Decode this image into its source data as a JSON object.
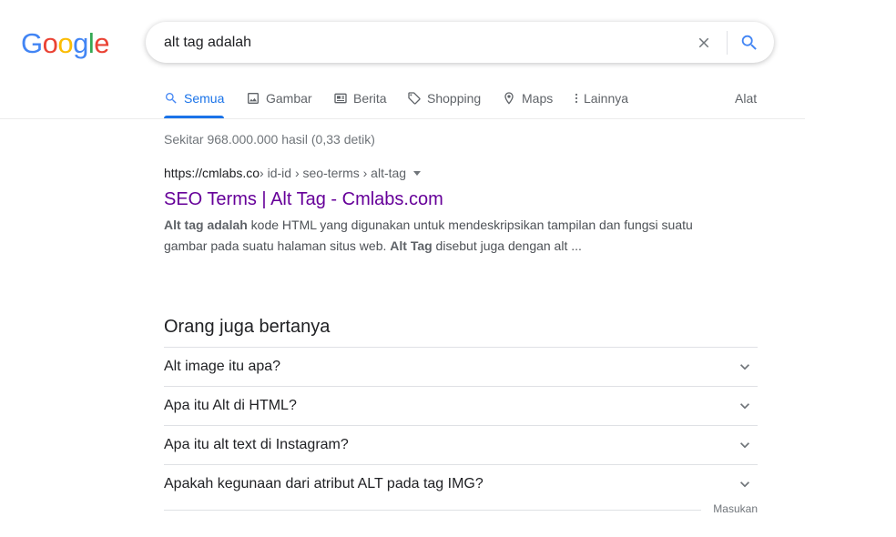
{
  "logo": {
    "letters": [
      "G",
      "o",
      "o",
      "g",
      "l",
      "e"
    ],
    "colors": [
      "#4285F4",
      "#EA4335",
      "#FBBC05",
      "#4285F4",
      "#34A853",
      "#EA4335"
    ]
  },
  "search": {
    "query": "alt tag adalah",
    "clear_icon": "close-icon",
    "search_icon": "search-icon"
  },
  "tabs": {
    "items": [
      {
        "label": "Semua",
        "icon": "search-icon",
        "active": true
      },
      {
        "label": "Gambar",
        "icon": "image-icon"
      },
      {
        "label": "Berita",
        "icon": "news-icon"
      },
      {
        "label": "Shopping",
        "icon": "tag-icon"
      },
      {
        "label": "Maps",
        "icon": "map-pin-icon"
      },
      {
        "label": "Lainnya",
        "icon": "more-vert-icon"
      }
    ],
    "tools_label": "Alat"
  },
  "stats": "Sekitar 968.000.000 hasil (0,33 detik)",
  "result": {
    "url_domain": "https://cmlabs.co",
    "url_path": " › id-id › seo-terms › alt-tag",
    "title": "SEO Terms | Alt Tag - Cmlabs.com",
    "snippet": {
      "b1": "Alt tag adalah",
      "t1": " kode HTML yang digunakan untuk mendeskripsikan tampilan dan fungsi suatu gambar pada suatu halaman situs web. ",
      "b2": "Alt Tag",
      "t2": " disebut juga dengan alt ..."
    }
  },
  "paa": {
    "title": "Orang juga bertanya",
    "questions": [
      "Alt image itu apa?",
      "Apa itu Alt di HTML?",
      "Apa itu alt text di Instagram?",
      "Apakah kegunaan dari atribut ALT pada tag IMG?"
    ],
    "feedback": "Masukan"
  },
  "colors": {
    "accent": "#1a73e8",
    "visited_link": "#660099",
    "muted": "#70757a"
  }
}
